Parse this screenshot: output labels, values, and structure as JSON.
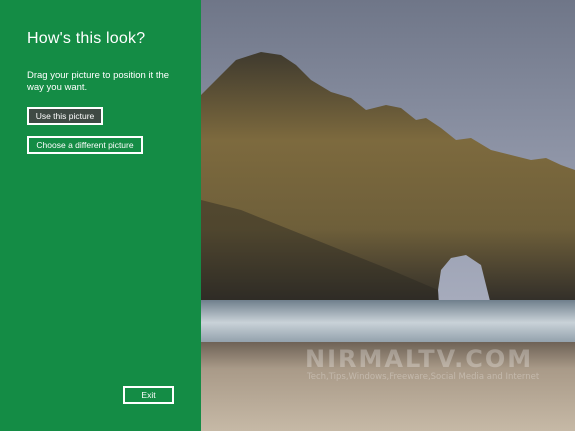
{
  "panel": {
    "title": "How's this look?",
    "description": "Drag your picture to position it the way you want.",
    "use_button": "Use this picture",
    "choose_button": "Choose a different picture",
    "exit_button": "Exit"
  },
  "watermark": {
    "main": "NIRMALTV.COM",
    "sub": "Tech,Tips,Windows,Freeware,Social Media and Internet"
  },
  "colors": {
    "panel_bg": "#148c45",
    "use_button_bg": "#3f4a44",
    "text": "#ffffff"
  },
  "icons": []
}
